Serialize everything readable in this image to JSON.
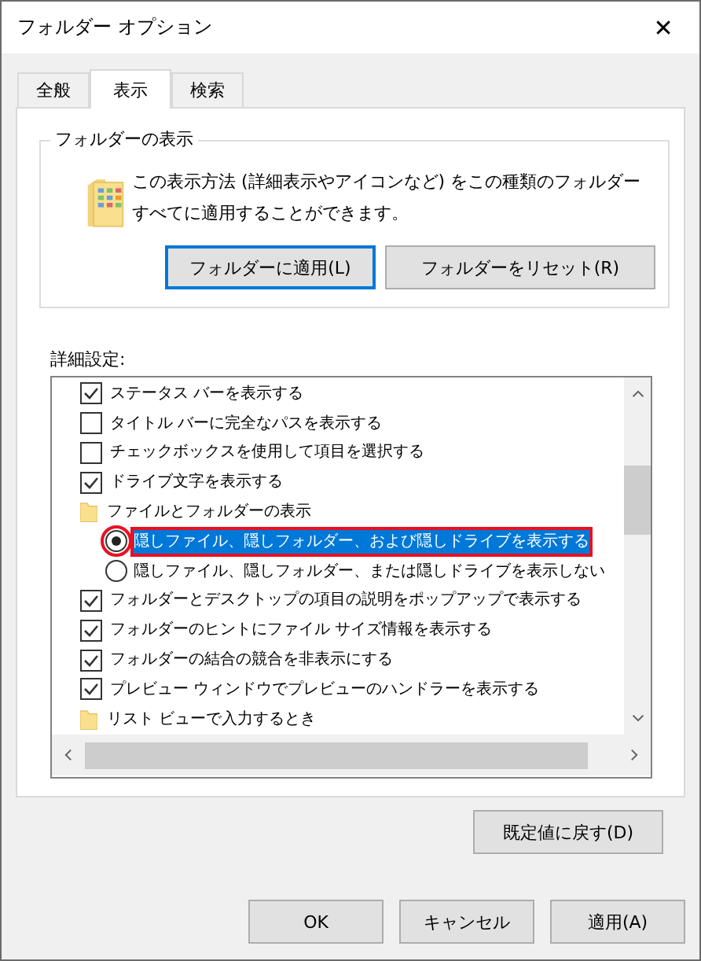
{
  "window": {
    "title": "フォルダー オプション",
    "close": "✕"
  },
  "tabs": [
    {
      "label": "全般",
      "selected": false
    },
    {
      "label": "表示",
      "selected": true
    },
    {
      "label": "検索",
      "selected": false
    }
  ],
  "folder_views": {
    "title": "フォルダーの表示",
    "description": "この表示方法 (詳細表示やアイコンなど) をこの種類のフォルダーすべてに適用することができます。",
    "buttons": [
      {
        "label": "フォルダーに適用(L)",
        "focused": true
      },
      {
        "label": "フォルダーをリセット(R)",
        "focused": false
      }
    ]
  },
  "advanced": {
    "label": "詳細設定:",
    "items": [
      {
        "kind": "checkbox",
        "label": "ステータス バーを表示する",
        "checked": true
      },
      {
        "kind": "checkbox",
        "label": "タイトル バーに完全なパスを表示する",
        "checked": false
      },
      {
        "kind": "checkbox",
        "label": "チェックボックスを使用して項目を選択する",
        "checked": false
      },
      {
        "kind": "checkbox",
        "label": "ドライブ文字を表示する",
        "checked": true
      },
      {
        "kind": "folder",
        "label": "ファイルとフォルダーの表示",
        "children": [
          {
            "kind": "radio",
            "label": "隠しファイル、隠しフォルダー、および隠しドライブを表示する",
            "selected": true,
            "highlighted": true
          },
          {
            "kind": "radio",
            "label": "隠しファイル、隠しフォルダー、または隠しドライブを表示しない",
            "selected": false,
            "highlighted": false
          }
        ]
      },
      {
        "kind": "checkbox",
        "label": "フォルダーとデスクトップの項目の説明をポップアップで表示する",
        "checked": true
      },
      {
        "kind": "checkbox",
        "label": "フォルダーのヒントにファイル サイズ情報を表示する",
        "checked": true
      },
      {
        "kind": "checkbox",
        "label": "フォルダーの結合の競合を非表示にする",
        "checked": true
      },
      {
        "kind": "checkbox",
        "label": "プレビュー ウィンドウでプレビューのハンドラーを表示する",
        "checked": true
      },
      {
        "kind": "folder",
        "label": "リスト ビューで入力するとき"
      }
    ],
    "restore_button": "既定値に戻す(D)"
  },
  "buttons": [
    "OK",
    "キャンセル",
    "適用(A)"
  ]
}
